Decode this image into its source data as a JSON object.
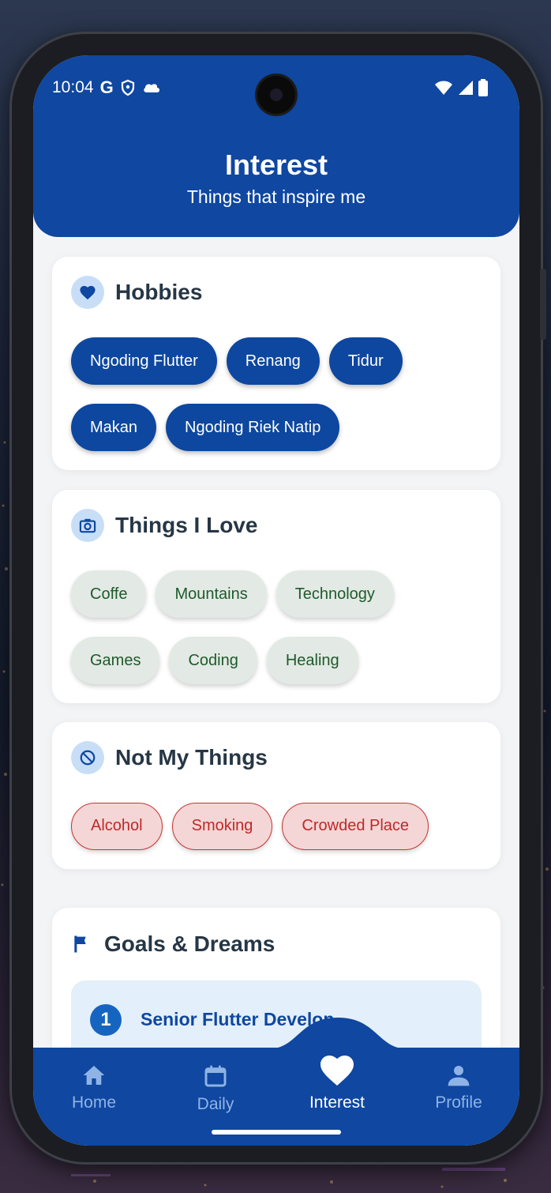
{
  "status_bar": {
    "time": "10:04",
    "g_label": "G",
    "icons": [
      "google-icon",
      "shield-icon",
      "cloud-icon",
      "wifi-icon",
      "signal-icon",
      "battery-icon"
    ]
  },
  "header": {
    "title": "Interest",
    "subtitle": "Things that inspire me"
  },
  "hobbies": {
    "title": "Hobbies",
    "icon": "heart-icon",
    "items": [
      "Ngoding Flutter",
      "Renang",
      "Tidur",
      "Makan",
      "Ngoding Riek Natip"
    ]
  },
  "love": {
    "title": "Things I Love",
    "icon": "camera-icon",
    "items": [
      "Coffe",
      "Mountains",
      "Technology",
      "Games",
      "Coding",
      "Healing"
    ]
  },
  "not_my_things": {
    "title": "Not My Things",
    "icon": "block-icon",
    "items": [
      "Alcohol",
      "Smoking",
      "Crowded Place"
    ]
  },
  "goals": {
    "title": "Goals & Dreams",
    "icon": "flag-icon",
    "items": [
      {
        "number": "1",
        "text": "Senior Flutter Develop"
      }
    ]
  },
  "bottom_nav": {
    "items": [
      {
        "label": "Home",
        "icon": "home-icon"
      },
      {
        "label": "Daily",
        "icon": "calendar-icon"
      },
      {
        "label": "Interest",
        "icon": "heart-icon"
      },
      {
        "label": "Profile",
        "icon": "person-icon"
      }
    ],
    "active": "Interest"
  },
  "colors": {
    "primary": "#0f47a1",
    "love_chip_bg": "#e3e9e4",
    "love_chip_text": "#1d5b2c",
    "not_chip_bg": "#f4d6d6",
    "not_chip_text": "#c02828"
  }
}
